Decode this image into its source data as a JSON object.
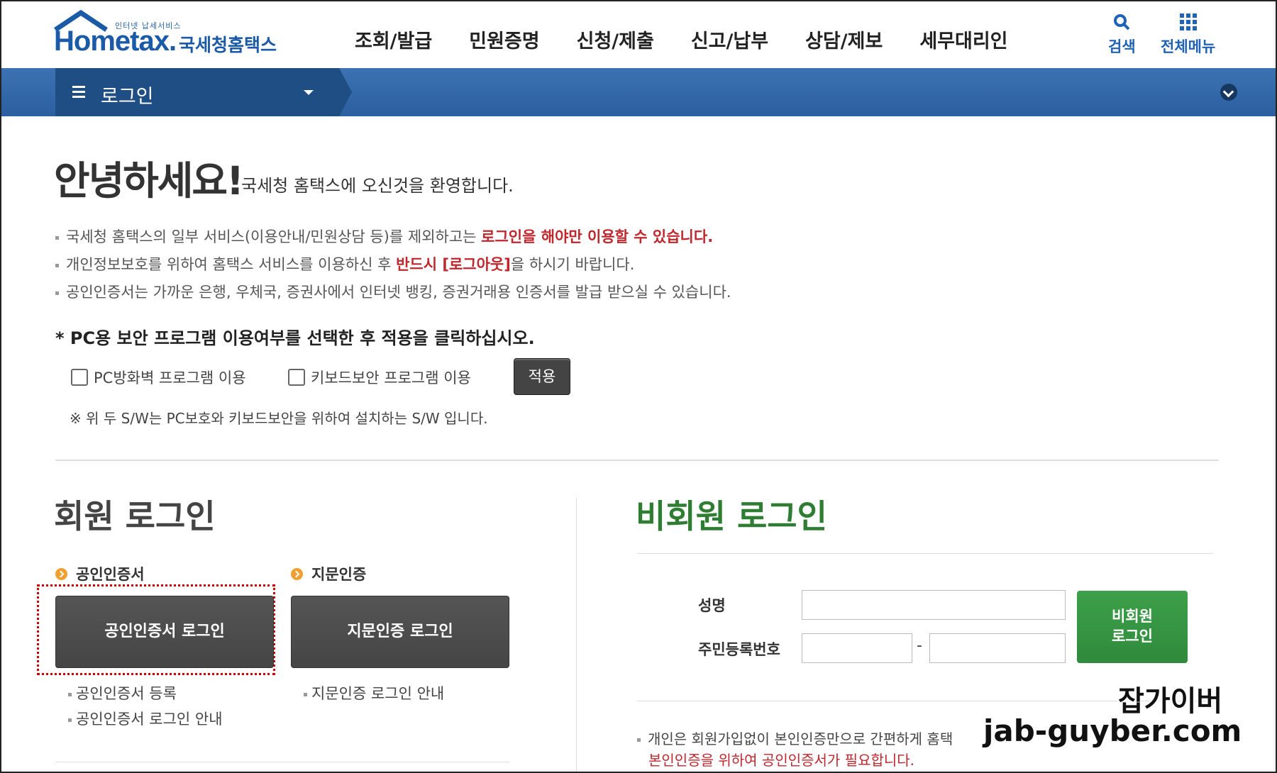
{
  "logo": {
    "small": "인터넷 납세서비스",
    "main": "Hometax.",
    "kr": "국세청홈택스"
  },
  "nav": [
    "조회/발급",
    "민원증명",
    "신청/제출",
    "신고/납부",
    "상담/제보",
    "세무대리인"
  ],
  "util": {
    "search": "검색",
    "all_menu": "전체메뉴"
  },
  "menubar": {
    "label": "로그인"
  },
  "greeting": {
    "title": "안녕하세요!",
    "subtitle": "국세청 홈택스에 오신것을 환영합니다."
  },
  "notices": [
    {
      "text": "국세청 홈택스의 일부 서비스(이용안내/민원상담 등)를 제외하고는 ",
      "em": "로그인을 해야만 이용할 수 있습니다."
    },
    {
      "text": "개인정보보호를 위하여 홈택스 서비스를 이용하신 후 ",
      "em": "반드시 [로그아웃]",
      "tail": "을 하시기 바랍니다."
    },
    {
      "text": "공인인증서는 가까운 은행, 우체국, 증권사에서 인터넷 뱅킹, 증권거래용 인증서를 발급 받으실 수 있습니다."
    }
  ],
  "security": {
    "title": "* PC용 보안 프로그램 이용여부를 선택한 후 적용을 클릭하십시오.",
    "firewall": "PC방화벽 프로그램 이용",
    "keyboard": "키보드보안 프로그램 이용",
    "apply": "적용",
    "note": "※ 위 두 S/W는 PC보호와 키보드보안을 위하여 설치하는 S/W 입니다."
  },
  "member": {
    "title": "회원 로그인",
    "cert_heading": "공인인증서",
    "finger_heading": "지문인증",
    "cert_btn": "공인인증서 로그인",
    "finger_btn": "지문인증 로그인",
    "cert_register": "공인인증서 등록",
    "cert_guide": "공인인증서 로그인 안내",
    "finger_guide": "지문인증 로그인 안내"
  },
  "nonmember": {
    "title": "비회원 로그인",
    "name_label": "성명",
    "rrn_label": "주민등록번호",
    "dash": "-",
    "btn_line1": "비회원",
    "btn_line2": "로그인",
    "note": "개인은 회원가입없이 본인인증만으로 간편하게 홈택",
    "note2": "본인인증을 위하여 공인인증서가 필요합니다."
  },
  "watermark": {
    "line1": "잡가이버",
    "line2": "jab-guyber.com"
  },
  "colors": {
    "primary_blue": "#2b5f9f",
    "dark_blue": "#1f4e85",
    "red": "#c0272d",
    "green": "#2e7d32"
  }
}
